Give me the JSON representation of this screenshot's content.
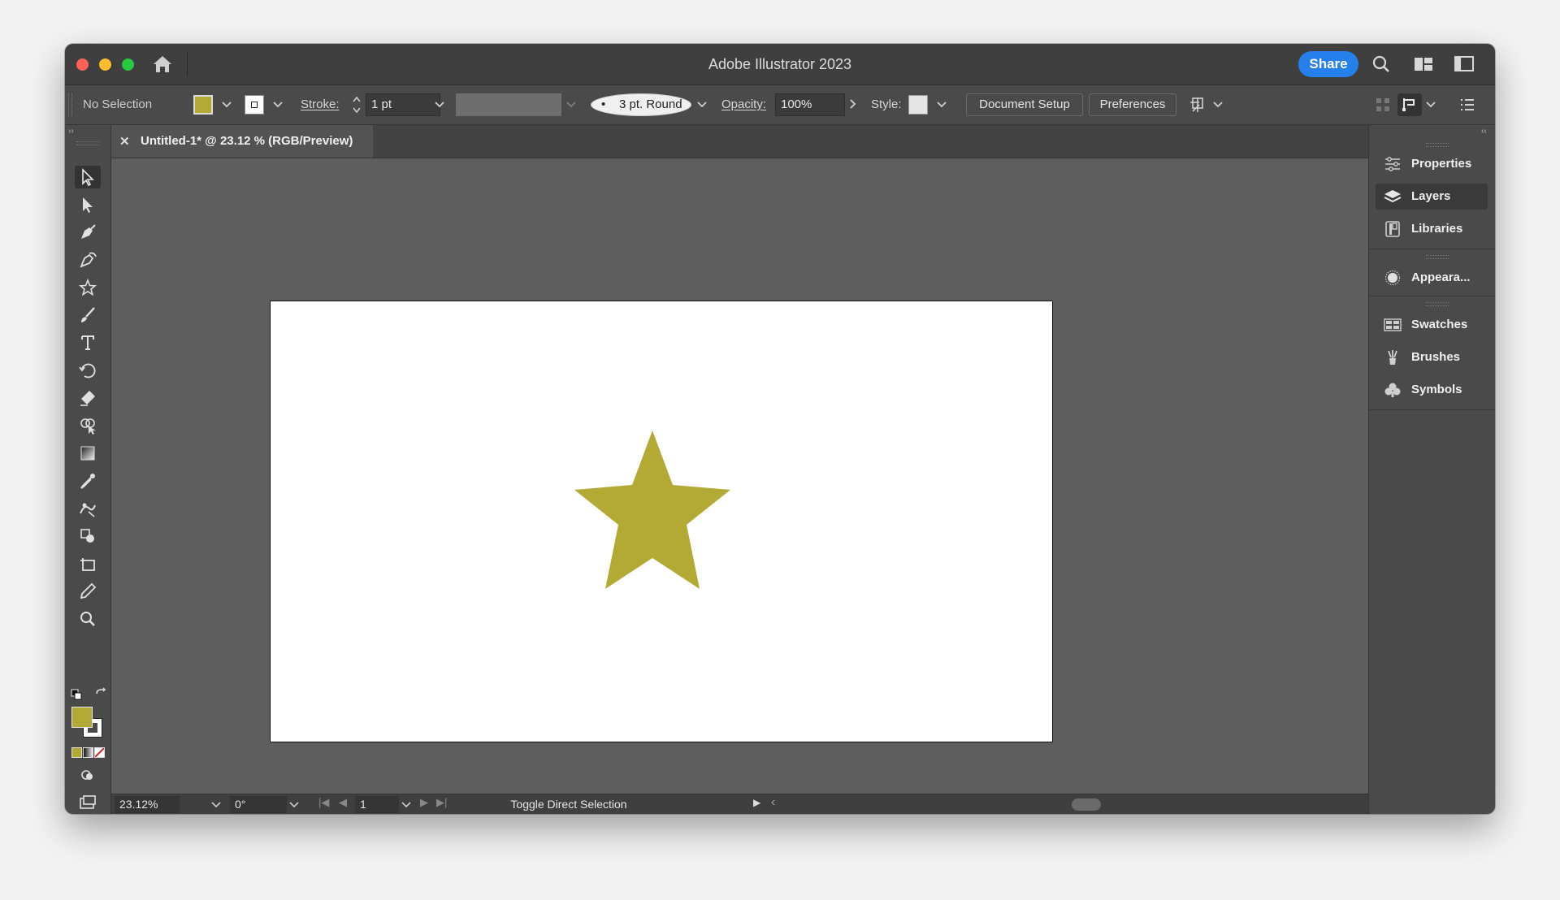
{
  "window": {
    "title": "Adobe Illustrator 2023",
    "share_label": "Share"
  },
  "control_bar": {
    "selection_label": "No Selection",
    "fill_color": "#b3aa35",
    "stroke_label": "Stroke:",
    "stroke_weight": "1 pt",
    "brush_label": "3 pt. Round",
    "opacity_label": "Opacity:",
    "opacity_value": "100%",
    "style_label": "Style:",
    "document_setup_label": "Document Setup",
    "preferences_label": "Preferences"
  },
  "document": {
    "tab_label": "Untitled-1* @ 23.12 % (RGB/Preview)"
  },
  "artwork": {
    "star_color": "#b3aa35",
    "artboard_color": "#ffffff"
  },
  "tools": [
    "selection-tool",
    "direct-selection-tool",
    "pen-tool",
    "curvature-tool",
    "star-tool",
    "paintbrush-tool",
    "type-tool",
    "rotate-tool",
    "eraser-tool",
    "shape-builder-tool",
    "gradient-tool",
    "eyedropper-tool",
    "puppet-warp-tool",
    "live-paint-tool",
    "artboard-tool",
    "pencil-tool",
    "zoom-tool"
  ],
  "status_bar": {
    "zoom": "23.12%",
    "rotation": "0°",
    "artboard_number": "1",
    "status_text": "Toggle Direct Selection"
  },
  "panels": [
    {
      "label": "Properties",
      "icon": "properties-icon"
    },
    {
      "label": "Layers",
      "icon": "layers-icon",
      "active": true
    },
    {
      "label": "Libraries",
      "icon": "libraries-icon"
    },
    {
      "label": "Appeara...",
      "icon": "appearance-icon"
    },
    {
      "label": "Swatches",
      "icon": "swatches-icon"
    },
    {
      "label": "Brushes",
      "icon": "brushes-icon"
    },
    {
      "label": "Symbols",
      "icon": "symbols-icon"
    }
  ]
}
